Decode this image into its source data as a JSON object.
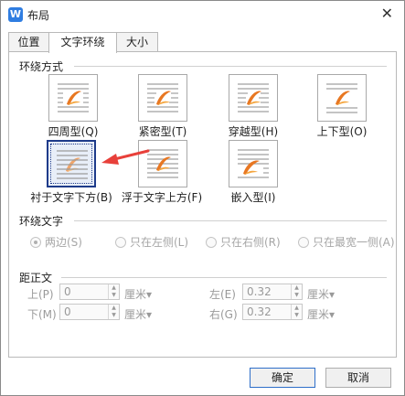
{
  "window": {
    "title": "布局",
    "app_icon_glyph": "W",
    "close_glyph": "✕"
  },
  "tabs": [
    {
      "label": "位置"
    },
    {
      "label": "文字环绕"
    },
    {
      "label": "大小"
    }
  ],
  "active_tab": "文字环绕",
  "wrap_style": {
    "heading": "环绕方式",
    "options": [
      {
        "label": "四周型(Q)",
        "icon": "square-wrap-icon"
      },
      {
        "label": "紧密型(T)",
        "icon": "tight-wrap-icon"
      },
      {
        "label": "穿越型(H)",
        "icon": "through-wrap-icon"
      },
      {
        "label": "上下型(O)",
        "icon": "top-bottom-wrap-icon"
      },
      {
        "label": "衬于文字下方(B)",
        "icon": "behind-text-icon"
      },
      {
        "label": "浮于文字上方(F)",
        "icon": "in-front-of-text-icon"
      },
      {
        "label": "嵌入型(I)",
        "icon": "inline-icon"
      }
    ],
    "selected": "衬于文字下方(B)"
  },
  "wrap_text": {
    "heading": "环绕文字",
    "options": [
      {
        "label": "两边(S)"
      },
      {
        "label": "只在左侧(L)"
      },
      {
        "label": "只在右侧(R)"
      },
      {
        "label": "只在最宽一侧(A)"
      }
    ],
    "selected": "两边(S)"
  },
  "distance": {
    "heading": "距正文",
    "top": {
      "label": "上(P)",
      "value": "0",
      "unit": "厘米▾"
    },
    "bottom": {
      "label": "下(M)",
      "value": "0",
      "unit": "厘米▾"
    },
    "left": {
      "label": "左(E)",
      "value": "0.32",
      "unit": "厘米▾"
    },
    "right": {
      "label": "右(G)",
      "value": "0.32",
      "unit": "厘米▾"
    }
  },
  "buttons": {
    "ok": "确定",
    "cancel": "取消"
  },
  "colors": {
    "accent": "#1e3b8a",
    "annotation_arrow": "#e8403a",
    "icon_orange": "#e87722"
  }
}
